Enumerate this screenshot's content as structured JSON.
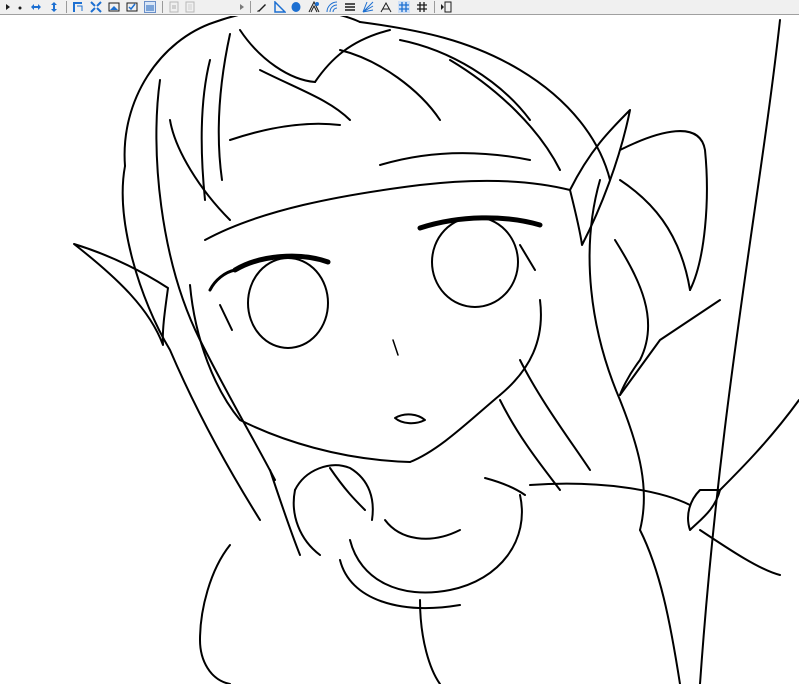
{
  "app": {
    "toolbar_tools": [
      "arrow-right-small-icon",
      "dot-icon",
      "flip-horizontal-icon",
      "flip-vertical-icon",
      "crop-icon",
      "fit-screen-icon",
      "image-ruler-icon",
      "image-check-icon",
      "selection-icon",
      "page-icon",
      "page-copy-icon",
      "arrow-right-small-icon",
      "pen-icon",
      "ruler-triangle-icon",
      "ellipse-ruler-icon",
      "vanishing-point-icon",
      "concentric-ruler-icon",
      "parallel-lines-icon",
      "radial-ruler-icon",
      "perspective-icon",
      "grid-icon",
      "grid-dark-icon",
      "panel-toggle-icon"
    ],
    "accent_color": "#1c6fd1",
    "toolbar_bg": "#f0f0f0"
  },
  "canvas": {
    "content": "line-art-illustration",
    "background": "#ffffff",
    "stroke": "#000000"
  }
}
